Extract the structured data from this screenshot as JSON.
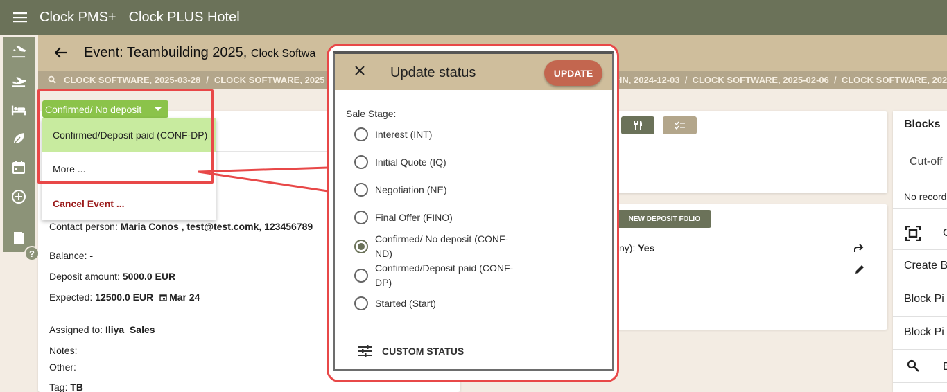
{
  "app": {
    "name": "Clock PMS+",
    "hotel": "Clock PLUS Hotel"
  },
  "rail": {
    "icons": [
      "airplane-arrival-icon",
      "airplane-departure-icon",
      "bed-icon",
      "leaf-icon",
      "calendar-icon",
      "add-circle-icon",
      "book-icon"
    ],
    "help": "?"
  },
  "event": {
    "title": "Event: Teambuilding 2025, ",
    "subtitle": "Clock Softwa"
  },
  "breadcrumb": {
    "left": [
      "CLOCK SOFTWARE, 2025-03-28",
      "/",
      "CLOCK SOFTWARE, 2025"
    ],
    "right": "HN, 2024-12-03  /  CLOCK SOFTWARE, 2025-02-06  /  CLOCK SOFTWARE, 2025"
  },
  "status": {
    "current": "Confirmed/ No deposit",
    "menu": [
      "Confirmed/Deposit paid (CONF-DP)",
      "More ...",
      "Cancel Event ..."
    ]
  },
  "details": {
    "contact_label": "Contact person: ",
    "contact_value": "Maria Conos , test@test.comk, 123456789",
    "balance_label": "Balance: ",
    "balance_value": "-",
    "deposit_label": "Deposit amount: ",
    "deposit_value": "5000.0 EUR",
    "expected_label": "Expected: ",
    "expected_value": "12500.0 EUR",
    "expected_date": "Mar 24",
    "assigned_label": "Assigned to: ",
    "assigned_value": "Iliya  Sales",
    "notes_label": "Notes:",
    "other_label": "Other:",
    "tag_label": "Tag: ",
    "tag_value": "TB"
  },
  "middle": {
    "deposit_folio_btn": "NEW DEPOSIT FOLIO",
    "company_fragment": "ny): ",
    "company_value": "Yes"
  },
  "side": {
    "blocks": "Blocks",
    "cutoff": "Cut-off",
    "no_records": "No record",
    "create": "Create B",
    "block_pi_1": "Block Pi",
    "block_pi_2": "Block Pi",
    "qr_label": "C",
    "search_label": "E"
  },
  "modal": {
    "title": "Update status",
    "update_label": "UPDATE",
    "sale_stage_label": "Sale Stage:",
    "options": [
      {
        "label": "Interest (INT)",
        "selected": false
      },
      {
        "label": "Initial Quote (IQ)",
        "selected": false
      },
      {
        "label": "Negotiation (NE)",
        "selected": false
      },
      {
        "label": "Final Offer (FINO)",
        "selected": false
      },
      {
        "label": "Confirmed/ No deposit (CONF-ND)",
        "selected": true
      },
      {
        "label": "Confirmed/Deposit paid (CONF-DP)",
        "selected": false
      },
      {
        "label": "Started (Start)",
        "selected": false
      }
    ],
    "custom_status": "CUSTOM STATUS"
  },
  "colors": {
    "topbar": "#6b7259",
    "tan": "#cfbe9c",
    "green": "#8bc34a",
    "update": "#c3664f",
    "highlight_red": "#e84848"
  }
}
